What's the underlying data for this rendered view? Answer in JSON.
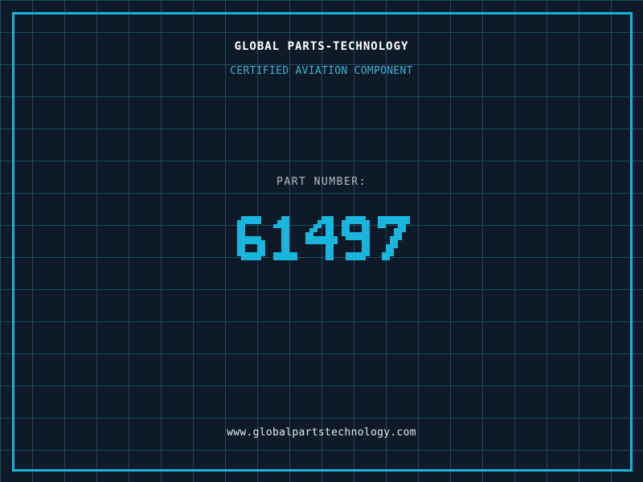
{
  "colors": {
    "background": "#0f1a28",
    "grid_line": "#1d4a5f",
    "frame": "#16b3da",
    "title": "#ffffff",
    "tagline": "#3fafd4",
    "label": "#b4bcc4",
    "part_number": "#1ab5dc",
    "url": "#e6e9ec"
  },
  "header": {
    "company_name": "GLOBAL PARTS-TECHNOLOGY",
    "tagline": "CERTIFIED AVIATION COMPONENT"
  },
  "part": {
    "label": "PART NUMBER:",
    "number": "61497"
  },
  "footer": {
    "website_url": "www.globalpartstechnology.com"
  }
}
